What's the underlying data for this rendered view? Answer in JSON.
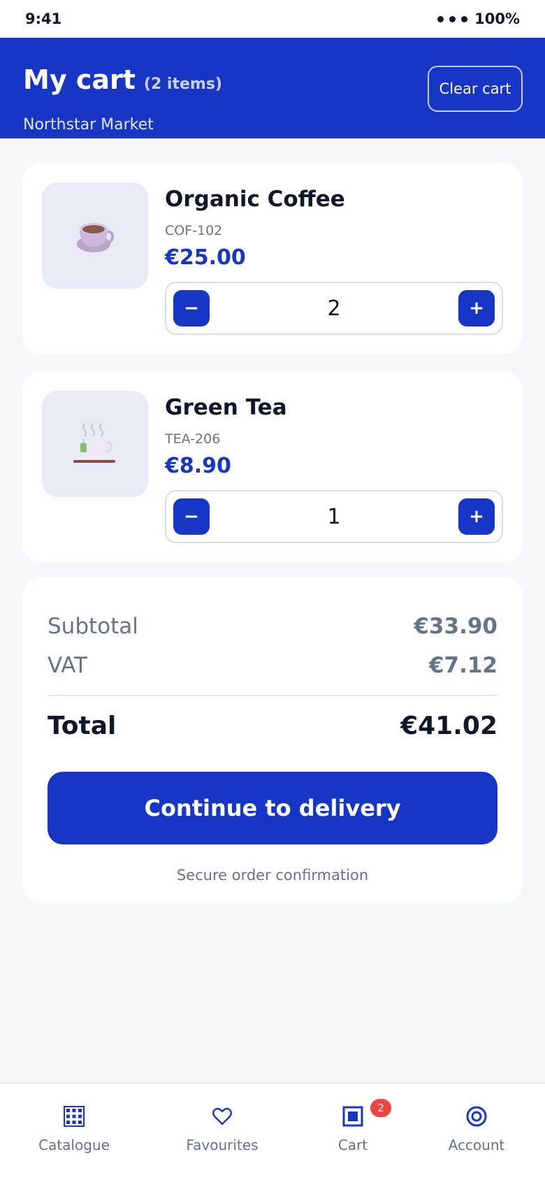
{
  "status_bar": {
    "time": "9:41",
    "battery": "100%"
  },
  "header": {
    "title": "My cart",
    "count": "(2 items)",
    "store": "Northstar Market",
    "clear_label": "Clear cart"
  },
  "items": [
    {
      "name": "Organic Coffee",
      "sku": "COF-102",
      "price": "€25.00",
      "quantity": "2",
      "icon": "coffee-cup-icon"
    },
    {
      "name": "Green Tea",
      "sku": "TEA-206",
      "price": "€8.90",
      "quantity": "1",
      "icon": "tea-cup-icon"
    }
  ],
  "stepper": {
    "minus": "−",
    "plus": "+"
  },
  "summary": {
    "subtotal_label": "Subtotal",
    "subtotal_value": "€33.90",
    "vat_label": "VAT",
    "vat_value": "€7.12",
    "total_label": "Total",
    "total_value": "€41.02",
    "cta_label": "Continue to delivery",
    "secure_note": "Secure order confirmation"
  },
  "tabs": [
    {
      "label": "Catalogue",
      "icon": "grid-icon"
    },
    {
      "label": "Favourites",
      "icon": "heart-icon"
    },
    {
      "label": "Cart",
      "icon": "cart-icon",
      "badge": "2"
    },
    {
      "label": "Account",
      "icon": "account-icon"
    }
  ],
  "colors": {
    "primary": "#1836c5",
    "badge": "#ef4444",
    "background": "#f5f7fb"
  }
}
